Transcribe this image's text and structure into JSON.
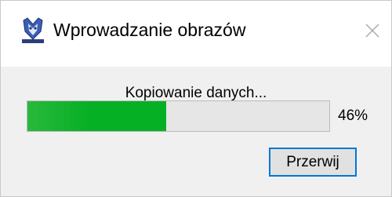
{
  "window": {
    "title": "Wprowadzanie obrazów",
    "app_icon": "scanner-app-icon",
    "close_icon": "close-icon"
  },
  "progress": {
    "status_text": "Kopiowanie danych...",
    "fraction": 0.46,
    "percent_label": "46%",
    "color": "#06b025"
  },
  "buttons": {
    "cancel_label": "Przerwij"
  }
}
